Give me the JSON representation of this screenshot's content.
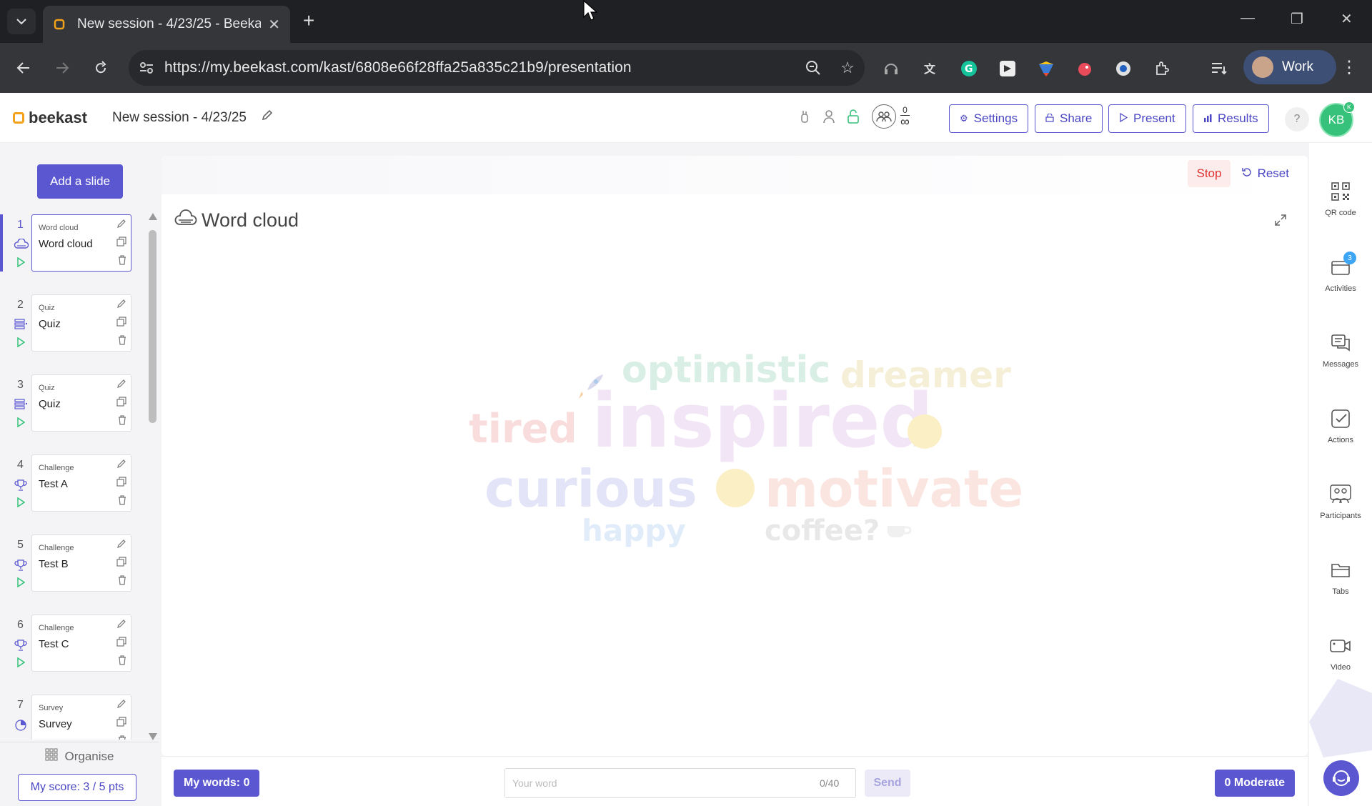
{
  "browser": {
    "tab_title": "New session - 4/23/25 - Beekast",
    "url": "https://my.beekast.com/kast/6808e66f28ffa25a835c21b9/presentation",
    "profile_label": "Work"
  },
  "header": {
    "logo_text": "beekast",
    "session_title": "New session - 4/23/25",
    "participants_count": "0",
    "participants_limit": "∞",
    "settings_label": "Settings",
    "share_label": "Share",
    "present_label": "Present",
    "results_label": "Results",
    "help_label": "?",
    "avatar_initials": "KB",
    "avatar_badge": "K"
  },
  "left_panel": {
    "add_slide_label": "Add a slide",
    "organise_label": "Organise",
    "score_label": "My score: 3 / 5 pts",
    "slides": [
      {
        "num": "1",
        "type": "Word cloud",
        "name": "Word cloud",
        "icon": "cloud-icon"
      },
      {
        "num": "2",
        "type": "Quiz",
        "name": "Quiz",
        "icon": "list-icon"
      },
      {
        "num": "3",
        "type": "Quiz",
        "name": "Quiz",
        "icon": "list-icon"
      },
      {
        "num": "4",
        "type": "Challenge",
        "name": "Test A",
        "icon": "trophy-icon"
      },
      {
        "num": "5",
        "type": "Challenge",
        "name": "Test B",
        "icon": "trophy-icon"
      },
      {
        "num": "6",
        "type": "Challenge",
        "name": "Test C",
        "icon": "trophy-icon"
      },
      {
        "num": "7",
        "type": "Survey",
        "name": "Survey",
        "icon": "pie-icon"
      }
    ]
  },
  "main": {
    "stop_label": "Stop",
    "reset_label": "Reset",
    "slide_title": "Word cloud",
    "words": {
      "optimistic": "optimistic",
      "dreamer": "dreamer",
      "tired": "tired",
      "inspired": "inspired",
      "curious": "curious",
      "motivate": "motivate",
      "happy": "happy",
      "coffee": "coffee?"
    },
    "my_words_label": "My words: 0",
    "input_placeholder": "Your word",
    "input_count": "0/40",
    "send_label": "Send",
    "moderate_label": "0 Moderate"
  },
  "right_rail": {
    "items": [
      {
        "label": "QR code"
      },
      {
        "label": "Activities",
        "badge": "3"
      },
      {
        "label": "Messages"
      },
      {
        "label": "Actions"
      },
      {
        "label": "Participants"
      },
      {
        "label": "Tabs"
      },
      {
        "label": "Video"
      }
    ]
  },
  "colors": {
    "accent": "#5b57d1",
    "stop": "#d33333",
    "avatar": "#36c27a"
  }
}
